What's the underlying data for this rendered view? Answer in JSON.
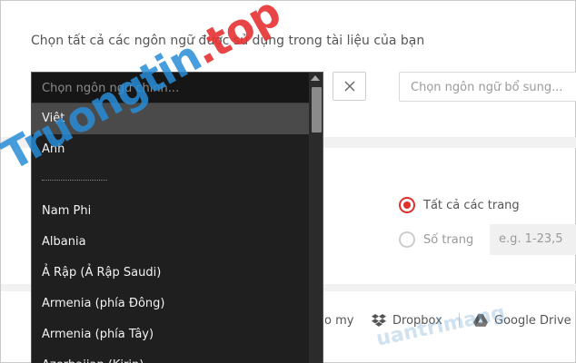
{
  "instruction": "Chọn tất cả các ngôn ngữ được sử dụng trong tài liệu của bạn",
  "language_select": {
    "placeholder": "Chọn ngôn ngữ chính...",
    "items": [
      "Việt",
      "Anh",
      "Nam Phi",
      "Albania",
      "Ả Rập (Ả Rập Saudi)",
      "Armenia (phía Đông)",
      "Armenia (phía Tây)",
      "Azerbaijan (Kirin)"
    ],
    "selected": "Việt"
  },
  "secondary_language": {
    "placeholder": "Chọn ngôn ngữ bổ sung..."
  },
  "pages": {
    "all_pages_label": "Tất cả các trang",
    "page_numbers_label": "Số trang",
    "range_placeholder": "e.g. 1-23,5",
    "selected": "all_pages"
  },
  "sources": {
    "my_label": "o my",
    "dropbox_label": "Dropbox",
    "google_drive_label": "Google Drive"
  },
  "watermark": {
    "main_text": "Truongtin",
    "main_suffix": ".top",
    "small_text": "uantrimang"
  },
  "colors": {
    "accent": "#e0312a",
    "dropdown_bg": "#1f1f1f",
    "selected_bg": "#4a4a4a"
  }
}
